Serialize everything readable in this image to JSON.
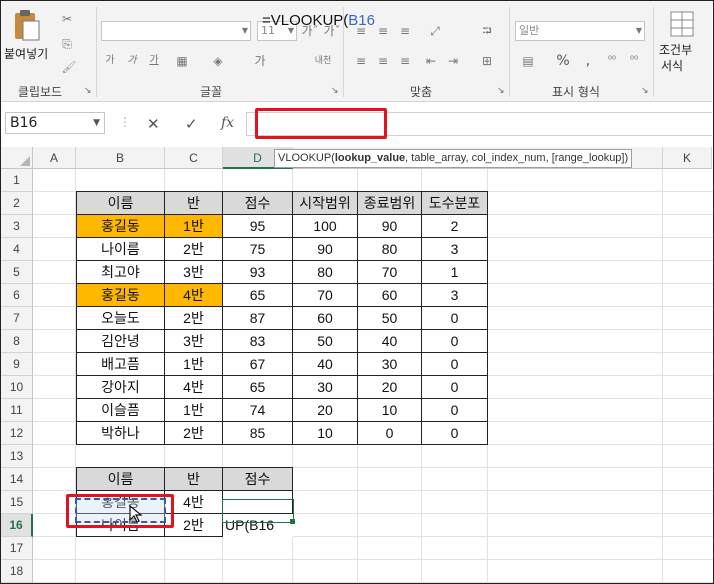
{
  "ribbon": {
    "clipboard": {
      "paste_label": "붙여넣기",
      "group_label": "클립보드"
    },
    "font": {
      "font_size": "11",
      "group_label": "글꼴"
    },
    "alignment": {
      "group_label": "맞춤"
    },
    "number": {
      "format": "일반",
      "group_label": "표시 형식"
    },
    "styles": {
      "conditional_label": "조건부",
      "format_label": "서식"
    },
    "icons": [
      "paste-icon",
      "cut-icon",
      "copy-icon",
      "format-painter-icon",
      "bold-icon",
      "italic-icon",
      "underline-icon",
      "increase-font-icon",
      "decrease-font-icon",
      "wrap-text-icon",
      "percent-icon",
      "comma-icon",
      "currency-icon",
      "conditional-format-icon"
    ]
  },
  "formula_bar": {
    "name_box": "B16",
    "fx_label": "fx",
    "formula_prefix": "=VLOOKUP(",
    "formula_ref": "B16"
  },
  "tooltip": {
    "fn": "VLOOKUP(",
    "arg1": "lookup_value",
    "rest": ", table_array, col_index_num, [range_lookup])"
  },
  "columns": [
    "A",
    "B",
    "C",
    "D",
    "K"
  ],
  "rows": [
    "1",
    "2",
    "3",
    "4",
    "5",
    "6",
    "7",
    "8",
    "9",
    "10",
    "11",
    "12",
    "13",
    "14",
    "15",
    "16",
    "17",
    "18"
  ],
  "table1": {
    "headers": [
      "이름",
      "반",
      "점수",
      "시작범위",
      "종료범위",
      "도수분포"
    ],
    "rows": [
      [
        "홍길동",
        "1반",
        "95",
        "100",
        "90",
        "2"
      ],
      [
        "나이름",
        "2반",
        "75",
        "90",
        "80",
        "3"
      ],
      [
        "최고야",
        "3반",
        "93",
        "80",
        "70",
        "1"
      ],
      [
        "홍길동",
        "4반",
        "65",
        "70",
        "60",
        "3"
      ],
      [
        "오늘도",
        "2반",
        "87",
        "60",
        "50",
        "0"
      ],
      [
        "김안녕",
        "3반",
        "83",
        "50",
        "40",
        "0"
      ],
      [
        "배고픔",
        "1반",
        "67",
        "40",
        "30",
        "0"
      ],
      [
        "강아지",
        "4반",
        "65",
        "30",
        "20",
        "0"
      ],
      [
        "이슬픔",
        "1반",
        "74",
        "20",
        "10",
        "0"
      ],
      [
        "박하나",
        "2반",
        "85",
        "10",
        "0",
        "0"
      ]
    ]
  },
  "table2": {
    "headers": [
      "이름",
      "반",
      "점수"
    ],
    "rows": [
      [
        "홍길동",
        "4반",
        ""
      ],
      [
        "나이름",
        "2반",
        "UP(B16"
      ]
    ]
  },
  "colors": {
    "highlight": "#ffb800",
    "header_fill": "#d9d9d9",
    "excel_green": "#217346",
    "annotation_red": "#e0141e",
    "reference_blue": "#3366cc"
  }
}
